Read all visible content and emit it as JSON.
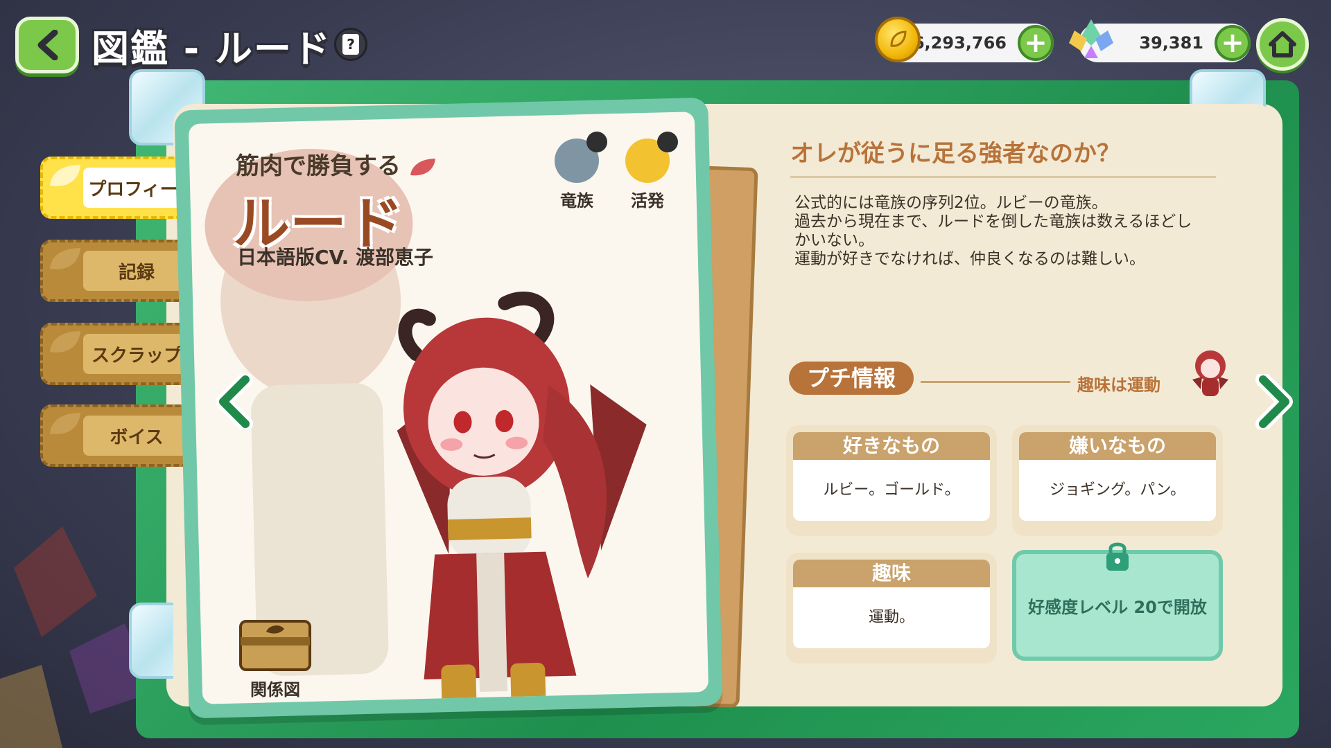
{
  "header": {
    "title": "図鑑 - ルード",
    "help_label": "?"
  },
  "currencies": {
    "gold": "6,293,766",
    "gems": "39,381"
  },
  "tabs": [
    {
      "label": "プロフィール",
      "active": true
    },
    {
      "label": "記録",
      "active": false
    },
    {
      "label": "スクラップ",
      "active": false
    },
    {
      "label": "ボイス",
      "active": false
    }
  ],
  "character": {
    "subtitle": "筋肉で勝負する",
    "name": "ルード",
    "cv": "日本語版CV. 渡部恵子",
    "race_label": "竜族",
    "trait_label": "活発",
    "relation_label": "関係図"
  },
  "profile": {
    "quote": "オレが従うに足る強者なのか？",
    "description": [
      "公式的には竜族の序列2位。ルビーの竜族。",
      "過去から現在まで、ルードを倒した竜族は数えるほどし",
      "かいない。",
      "運動が好きでなければ、仲良くなるのは難しい。"
    ]
  },
  "petit": {
    "title": "プチ情報",
    "hint": "趣味は運動",
    "likes_header": "好きなもの",
    "likes_value": "ルビー。ゴールド。",
    "dislikes_header": "嫌いなもの",
    "dislikes_value": "ジョギング。パン。",
    "hobby_header": "趣味",
    "hobby_value": "運動。",
    "locked_text": "好感度レベル 20で開放"
  },
  "colors": {
    "accent_green": "#7cc84a",
    "card_teal": "#71c8a8",
    "brown": "#b8733a"
  }
}
